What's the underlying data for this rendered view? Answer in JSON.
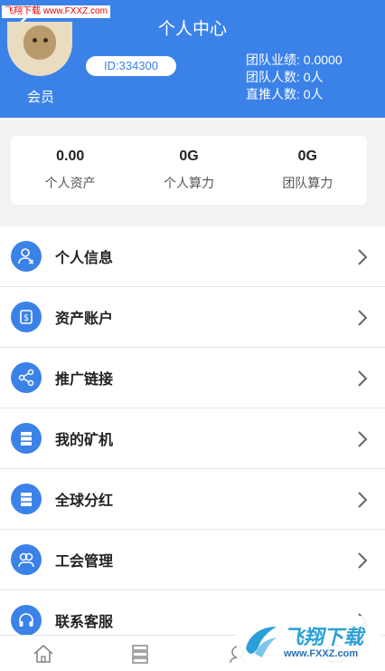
{
  "watermark_top": "飞翔下载 www.FXXZ.com",
  "header": {
    "title": "个人中心",
    "member_label": "会员",
    "id_label": "ID:334300",
    "team_performance": "团队业绩: 0.0000",
    "team_count": "团队人数: 0人",
    "direct_count": "直推人数: 0人"
  },
  "stats": [
    {
      "value": "0.00",
      "label": "个人资产"
    },
    {
      "value": "0G",
      "label": "个人算力"
    },
    {
      "value": "0G",
      "label": "团队算力"
    }
  ],
  "menu": [
    {
      "label": "个人信息",
      "icon": "user-icon"
    },
    {
      "label": "资产账户",
      "icon": "dollar-icon"
    },
    {
      "label": "推广链接",
      "icon": "share-icon"
    },
    {
      "label": "我的矿机",
      "icon": "server-icon"
    },
    {
      "label": "全球分红",
      "icon": "server-icon"
    },
    {
      "label": "工会管理",
      "icon": "group-icon"
    },
    {
      "label": "联系客服",
      "icon": "headset-icon"
    }
  ],
  "watermark_logo": {
    "big": "飞翔下载",
    "small": "www.FXXZ.com"
  },
  "colors": {
    "primary": "#3b82e8",
    "background": "#f2f2f2"
  }
}
